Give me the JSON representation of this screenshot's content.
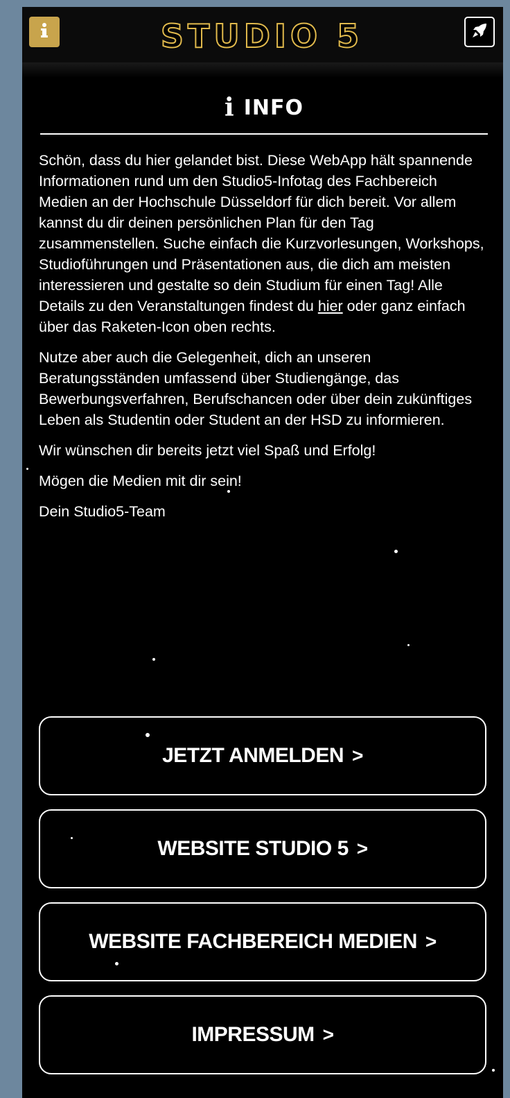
{
  "header": {
    "logo_text": "STUDIO 5",
    "info_icon": "info-icon",
    "rocket_icon": "rocket-icon",
    "brand_color": "#c8a44c"
  },
  "section": {
    "icon_glyph": "i",
    "title": "INFO"
  },
  "content": {
    "paragraph1_before_link": "Schön, dass du hier gelandet bist. Diese WebApp hält spannende Informationen rund um den Studio5-Infotag des Fachbereich Medien an der Hochschule Düsseldorf für dich bereit. Vor allem kannst du dir deinen persönlichen Plan für den Tag zusammenstellen. Suche einfach die Kurzvorlesungen, Workshops, Studioführungen und Präsentationen aus, die dich am meisten interessieren und gestalte so dein Studium für einen Tag! Alle Details zu den Veranstaltungen findest du ",
    "paragraph1_link": "hier",
    "paragraph1_after_link": " oder ganz einfach über das Raketen-Icon oben rechts.",
    "paragraph2": "Nutze aber auch die Gelegenheit, dich an unseren Beratungsständen umfassend über Studiengänge, das Bewerbungsverfahren, Berufschancen oder über dein zukünftiges Leben als Studentin oder Student an der HSD zu informieren.",
    "paragraph3": "Wir wünschen dir bereits jetzt viel Spaß und Erfolg!",
    "paragraph4": "Mögen die Medien mit dir sein!",
    "paragraph5": "Dein Studio5-Team"
  },
  "buttons": [
    {
      "label": "JETZT ANMELDEN",
      "chevron": ">"
    },
    {
      "label": "WEBSITE STUDIO 5",
      "chevron": ">"
    },
    {
      "label": "WEBSITE FACHBEREICH MEDIEN",
      "chevron": ">"
    },
    {
      "label": "IMPRESSUM",
      "chevron": ">"
    }
  ]
}
